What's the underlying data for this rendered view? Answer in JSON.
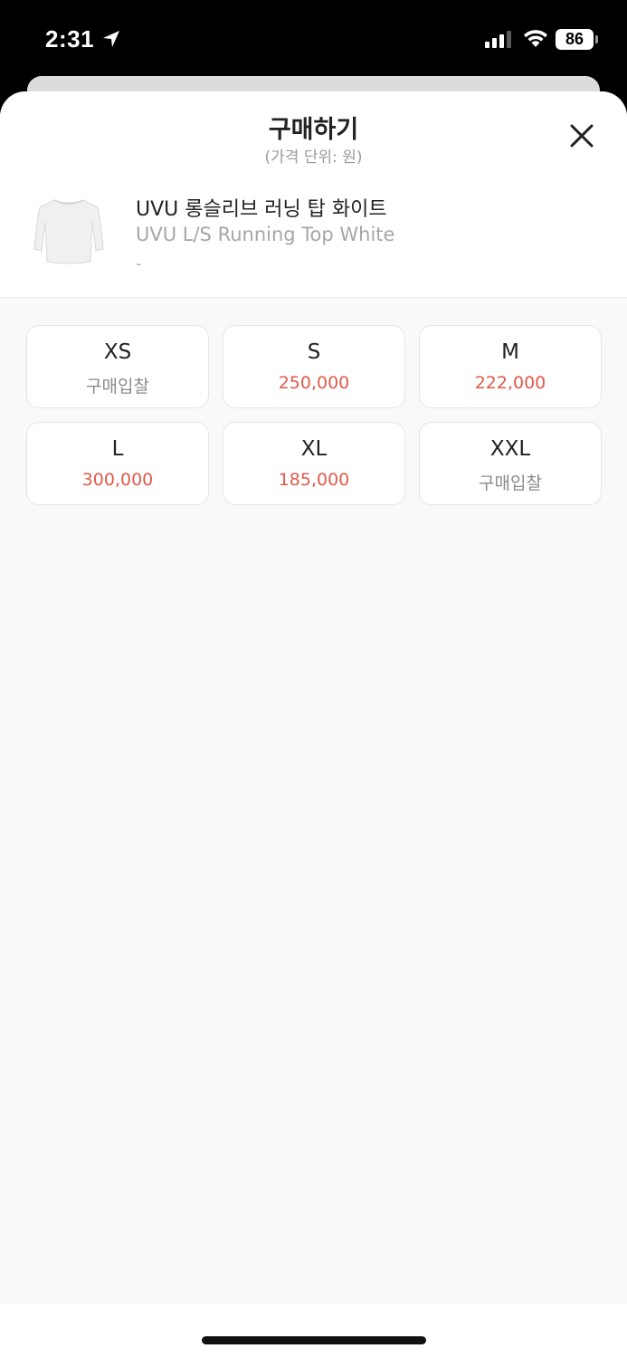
{
  "status_bar": {
    "time": "2:31",
    "battery": "86"
  },
  "header": {
    "title": "구매하기",
    "subtitle": "(가격 단위: 원)"
  },
  "product": {
    "name_ko": "UVU 롱슬리브 러닝 탑 화이트",
    "name_en": "UVU L/S Running Top White",
    "extra": "-"
  },
  "sizes": [
    {
      "label": "XS",
      "price": "구매입찰",
      "price_color": "gray"
    },
    {
      "label": "S",
      "price": "250,000",
      "price_color": "red"
    },
    {
      "label": "M",
      "price": "222,000",
      "price_color": "red"
    },
    {
      "label": "L",
      "price": "300,000",
      "price_color": "red"
    },
    {
      "label": "XL",
      "price": "185,000",
      "price_color": "red"
    },
    {
      "label": "XXL",
      "price": "구매입찰",
      "price_color": "gray"
    }
  ],
  "colors": {
    "price_red": "#e05a4a",
    "price_gray": "#8a8a8a",
    "sheet_bg": "#f9f9f9"
  },
  "icons": {
    "location": "location-arrow-icon",
    "signal": "cellular-signal-icon",
    "wifi": "wifi-icon",
    "close": "close-icon"
  }
}
